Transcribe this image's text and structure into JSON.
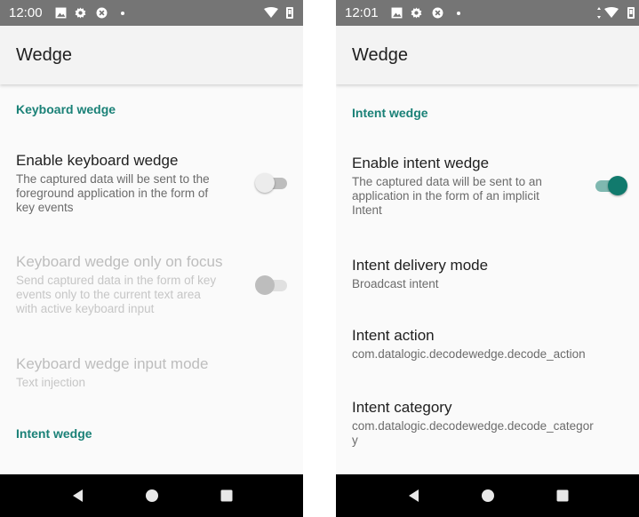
{
  "left": {
    "status": {
      "time": "12:00",
      "icons": [
        "image-icon",
        "gear-icon",
        "blocked-icon",
        "dot-icon",
        "wifi-icon",
        "battery-icon"
      ]
    },
    "app_title": "Wedge",
    "category_keyboard": "Keyboard wedge",
    "enable_keyboard": {
      "title": "Enable keyboard wedge",
      "summary": "The captured data will be sent to the foreground application in the form of key events",
      "checked": false
    },
    "only_on_focus": {
      "title": "Keyboard wedge only on focus",
      "summary": "Send captured data in the form of key events only to the current text area with active keyboard input",
      "checked": false,
      "enabled": false
    },
    "input_mode": {
      "title": "Keyboard wedge input mode",
      "summary": "Text injection",
      "enabled": false
    },
    "category_intent": "Intent wedge",
    "nav": [
      "back-icon",
      "home-icon",
      "recents-icon"
    ]
  },
  "right": {
    "status": {
      "time": "12:01",
      "icons": [
        "image-icon",
        "gear-icon",
        "blocked-icon",
        "dot-icon",
        "data-arrows-icon",
        "wifi-icon",
        "battery-icon"
      ]
    },
    "app_title": "Wedge",
    "category_intent": "Intent wedge",
    "enable_intent": {
      "title": "Enable intent wedge",
      "summary": "The captured data will be sent to an application in the form of an implicit Intent",
      "checked": true
    },
    "delivery_mode": {
      "title": "Intent delivery mode",
      "summary": "Broadcast intent"
    },
    "intent_action": {
      "title": "Intent action",
      "summary": "com.datalogic.decodewedge.decode_action"
    },
    "intent_category": {
      "title": "Intent category",
      "summary": "com.datalogic.decodewedge.decode_categor\ny"
    },
    "nav": [
      "back-icon",
      "home-icon",
      "recents-icon"
    ]
  },
  "colors": {
    "accent": "#1a8177",
    "switch_on": "#117a6d",
    "status_bar": "#757575",
    "nav_bar": "#000000",
    "app_bar": "#f3f3f3"
  }
}
